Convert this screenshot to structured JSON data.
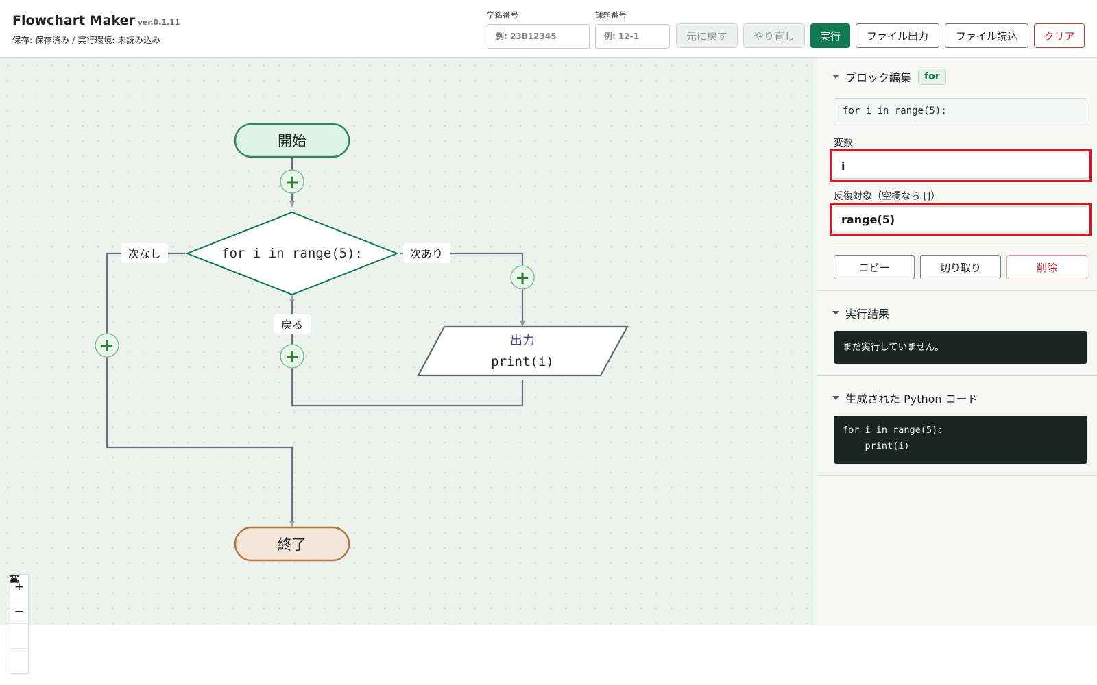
{
  "header": {
    "title": "Flowchart Maker",
    "version": "ver.0.1.11",
    "status": "保存: 保存済み / 実行環境: 未読み込み",
    "student_id_label": "学籍番号",
    "student_id_placeholder": "例: 23B12345",
    "task_id_label": "課題番号",
    "task_id_placeholder": "例: 12-1",
    "buttons": {
      "undo": "元に戻す",
      "redo": "やり直し",
      "run": "実行",
      "export": "ファイル出力",
      "import": "ファイル読込",
      "clear": "クリア"
    }
  },
  "flowchart": {
    "start": "開始",
    "loop_condition": "for i in range(5):",
    "branch_no_next": "次なし",
    "branch_has_next": "次あり",
    "back_label": "戻る",
    "output_title": "出力",
    "output_code": "print(i)",
    "end": "終了",
    "add_symbol": "+"
  },
  "zoom_controls": {
    "zoom_in": "+",
    "zoom_out": "−",
    "fit_icon": "fit-view-icon",
    "lock_icon": "lock-icon"
  },
  "panel": {
    "block_edit": {
      "title": "ブロック編集",
      "type_badge": "for",
      "code_preview": "for i in range(5):",
      "variable_label": "変数",
      "variable_value": "i",
      "iterable_label": "反復対象（空欄なら []）",
      "iterable_value": "range(5)",
      "copy": "コピー",
      "cut": "切り取り",
      "delete": "削除"
    },
    "result": {
      "title": "実行結果",
      "output": "まだ実行していません。"
    },
    "python_code": {
      "title": "生成された Python コード",
      "code": "for i in range(5):\n    print(i)"
    }
  },
  "colors": {
    "primary": "#0f7a52",
    "danger": "#c0262a",
    "highlight": "#e0121c",
    "start_fill": "#dff3e6",
    "end_fill": "#f5e6dc"
  }
}
